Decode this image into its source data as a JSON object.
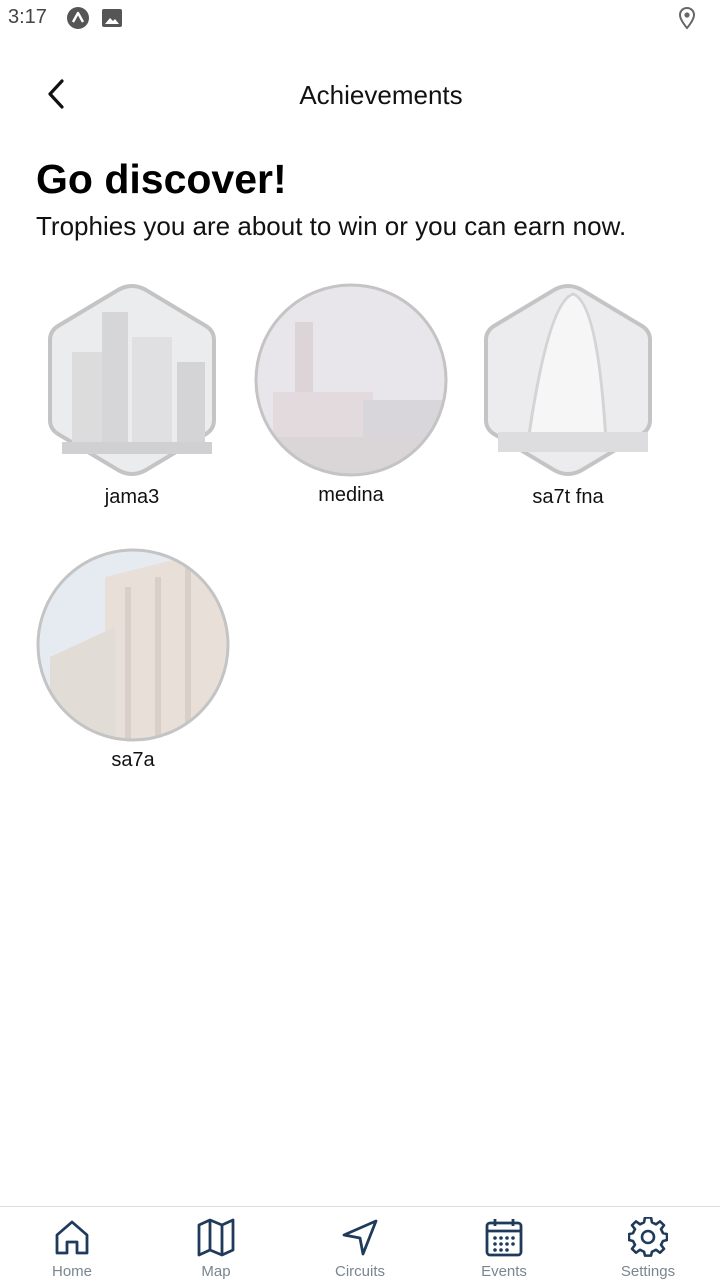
{
  "status_bar": {
    "time": "3:17"
  },
  "header": {
    "title": "Achievements"
  },
  "intro": {
    "headline": "Go discover!",
    "subline": "Trophies you are about to win or you can earn now."
  },
  "trophies": [
    {
      "label": "jama3"
    },
    {
      "label": "medina"
    },
    {
      "label": "sa7t fna"
    },
    {
      "label": "sa7a"
    }
  ],
  "bottom_nav": {
    "items": [
      {
        "label": "Home",
        "icon": "home-icon"
      },
      {
        "label": "Map",
        "icon": "map-icon"
      },
      {
        "label": "Circuits",
        "icon": "navigation-arrow-icon"
      },
      {
        "label": "Events",
        "icon": "calendar-icon"
      },
      {
        "label": "Settings",
        "icon": "gear-icon"
      }
    ]
  },
  "colors": {
    "nav_icon": "#1f3a5a",
    "nav_label": "#7a8591",
    "badge_border": "#bcbcbc",
    "badge_fill": "#e9eaec"
  }
}
